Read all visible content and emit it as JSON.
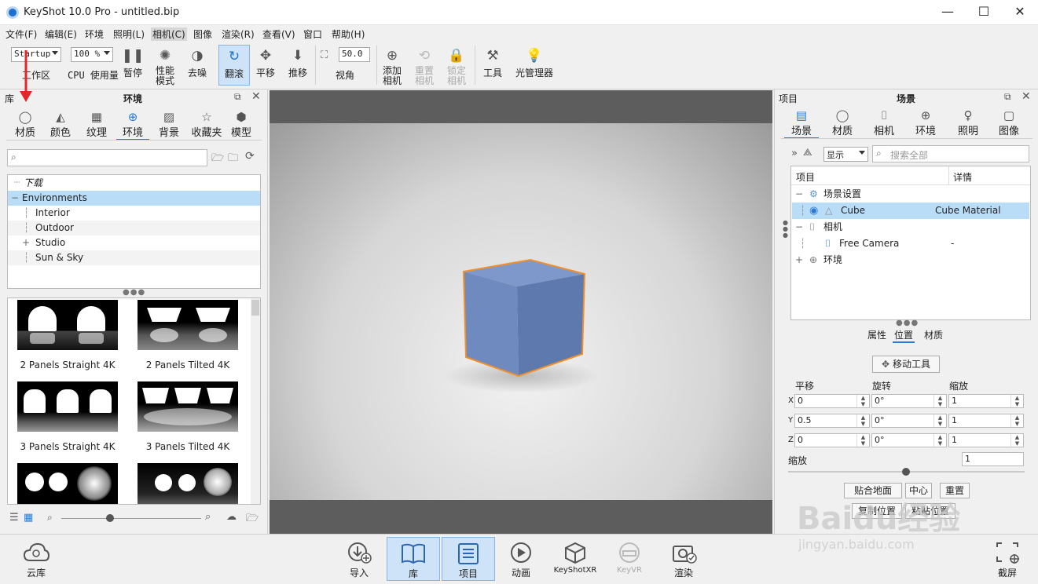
{
  "window": {
    "title": "KeyShot 10.0 Pro  - untitled.bip",
    "controls": [
      "—",
      "☐",
      "✕"
    ]
  },
  "menu": [
    "文件(F)",
    "编辑(E)",
    "环境",
    "照明(L)",
    "相机(C)",
    "图像",
    "渲染(R)",
    "查看(V)",
    "窗口",
    "帮助(H)"
  ],
  "toolbar": {
    "workspace_value": "Startup",
    "workspace_label": "工作区",
    "cpu_value": "100 %",
    "cpu_label": "CPU 使用量",
    "pause": "暂停",
    "perf_1": "性能",
    "perf_2": "模式",
    "denoise": "去噪",
    "tumble": "翻滚",
    "pan": "平移",
    "dolly": "推移",
    "fov_value": "50.0",
    "fov_label": "视角",
    "add_cam_1": "添加",
    "add_cam_2": "相机",
    "reset_cam_1": "重置",
    "reset_cam_2": "相机",
    "lock_cam_1": "锁定",
    "lock_cam_2": "相机",
    "tools": "工具",
    "light_mgr": "光管理器"
  },
  "library": {
    "panel_label": "库",
    "title": "环境",
    "tabs": [
      "材质",
      "颜色",
      "纹理",
      "环境",
      "背景",
      "收藏夹",
      "模型"
    ],
    "search_placeholder": "",
    "tree": [
      "下载",
      "Environments",
      "Interior",
      "Outdoor",
      "Studio",
      "Sun & Sky"
    ],
    "thumbs": [
      "2 Panels Straight 4K",
      "2 Panels Tilted 4K",
      "3 Panels Straight 4K",
      "3 Panels Tilted 4K"
    ]
  },
  "project": {
    "panel_label": "项目",
    "title": "场景",
    "tabs": [
      "场景",
      "材质",
      "相机",
      "环境",
      "照明",
      "图像"
    ],
    "display": "显示",
    "search_placeholder": "搜索全部",
    "col_item": "项目",
    "col_detail": "详情",
    "rows": [
      {
        "name": "场景设置",
        "detail": ""
      },
      {
        "name": "Cube",
        "detail": "Cube Material"
      },
      {
        "name": "相机",
        "detail": ""
      },
      {
        "name": "Free Camera",
        "detail": "-"
      },
      {
        "name": "环境",
        "detail": ""
      }
    ],
    "subtabs": [
      "属性",
      "位置",
      "材质"
    ],
    "move_tool": "移动工具",
    "labels": {
      "translate": "平移",
      "rotate": "旋转",
      "scale": "缩放",
      "uniform": "缩放"
    },
    "axes": [
      "X",
      "Y",
      "Z"
    ],
    "translate": [
      "0",
      "0.5",
      "0"
    ],
    "rotate": [
      "0°",
      "0°",
      "0°"
    ],
    "scale": [
      "1",
      "1",
      "1"
    ],
    "uniform_scale": "1",
    "buttons": [
      "贴合地面",
      "中心",
      "重置",
      "复制位置",
      "粘贴位置"
    ]
  },
  "bottom": {
    "cloud": "云库",
    "items": [
      "导入",
      "库",
      "项目",
      "动画",
      "KeyShotXR",
      "KeyVR",
      "渲染"
    ],
    "screenshot": "截屏"
  },
  "watermark": {
    "line1": "Baidu经验",
    "line2": "jingyan.baidu.com"
  },
  "colors": {
    "accent": "#2a7bd5",
    "selection": "#b9dcf7",
    "cube": "#6f89bf",
    "outline": "#f0902a",
    "arrow": "#e3262a"
  }
}
